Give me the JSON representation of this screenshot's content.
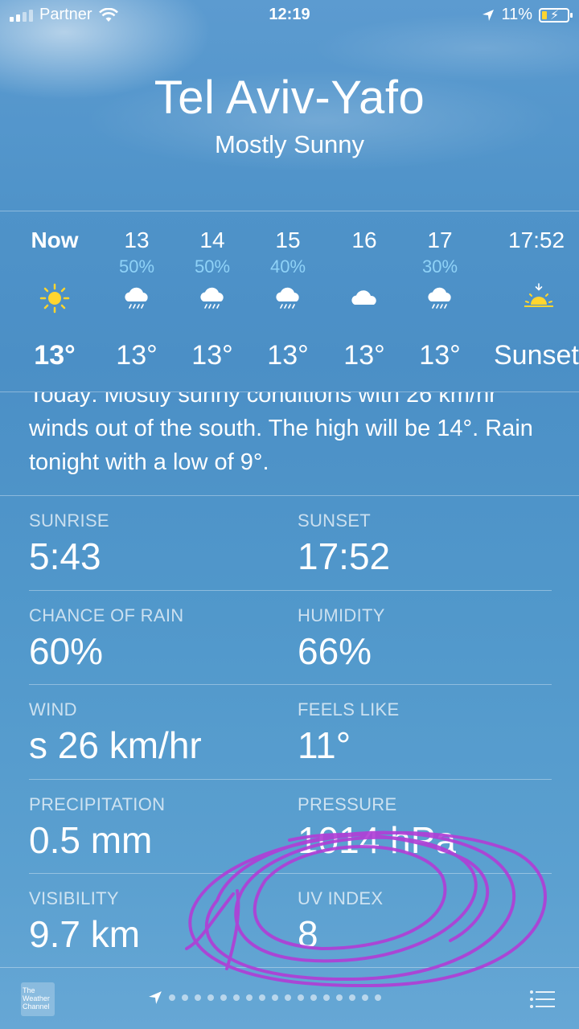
{
  "status_bar": {
    "carrier": "Partner",
    "time": "12:19",
    "battery": "11%"
  },
  "header": {
    "city": "Tel Aviv-Yafo",
    "condition": "Mostly Sunny"
  },
  "hourly": [
    {
      "time": "Now",
      "precip": "",
      "icon": "sun-icon",
      "temp": "13°",
      "bold": true
    },
    {
      "time": "13",
      "precip": "50%",
      "icon": "rain-cloud-icon",
      "temp": "13°"
    },
    {
      "time": "14",
      "precip": "50%",
      "icon": "rain-cloud-icon",
      "temp": "13°"
    },
    {
      "time": "15",
      "precip": "40%",
      "icon": "rain-cloud-icon",
      "temp": "13°"
    },
    {
      "time": "16",
      "precip": "",
      "icon": "cloud-icon",
      "temp": "13°"
    },
    {
      "time": "17",
      "precip": "30%",
      "icon": "rain-cloud-icon",
      "temp": "13°"
    },
    {
      "time": "17:52",
      "precip": "",
      "icon": "sunset-icon",
      "temp": "Sunset"
    }
  ],
  "summary": "Today: Mostly sunny conditions with 26 km/hr winds out of the south. The high will be 14°. Rain tonight with a low of 9°.",
  "details": {
    "sunrise": {
      "label": "SUNRISE",
      "value": "5:43"
    },
    "sunset": {
      "label": "SUNSET",
      "value": "17:52"
    },
    "chance_of_rain": {
      "label": "CHANCE OF RAIN",
      "value": "60%"
    },
    "humidity": {
      "label": "HUMIDITY",
      "value": "66%"
    },
    "wind": {
      "label": "WIND",
      "value": "s 26 km/hr"
    },
    "feels_like": {
      "label": "FEELS LIKE",
      "value": "11°"
    },
    "precipitation": {
      "label": "PRECIPITATION",
      "value": "0.5 mm"
    },
    "pressure": {
      "label": "PRESSURE",
      "value": "1014 hPa"
    },
    "visibility": {
      "label": "VISIBILITY",
      "value": "9.7 km"
    },
    "uv_index": {
      "label": "UV INDEX",
      "value": "8"
    }
  },
  "footer": {
    "brand_logo": "The Weather Channel",
    "page_count": 17
  },
  "colors": {
    "precip_text": "#8fd2f7",
    "sun": "#ffd52e",
    "annotation": "#b03fd6"
  }
}
